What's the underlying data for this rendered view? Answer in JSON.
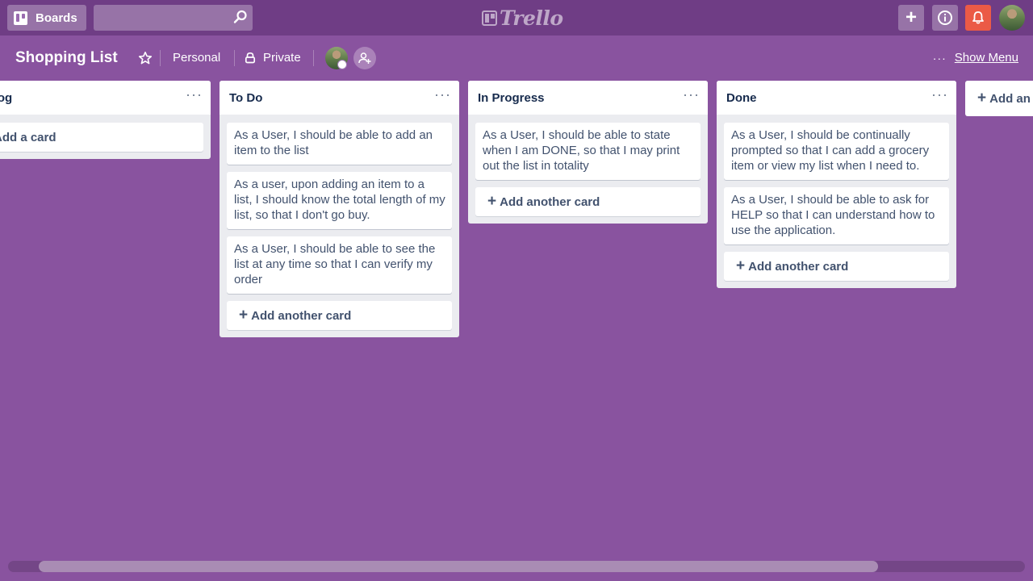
{
  "header": {
    "boards_label": "Boards",
    "search_value": "",
    "search_placeholder": "",
    "logo_text": "Trello",
    "add_icon_glyph": "+",
    "accent_color": "#6f3d85",
    "notification_color": "#eb5a46"
  },
  "board": {
    "title": "Shopping List",
    "team": "Personal",
    "visibility": "Private",
    "show_menu": "Show Menu",
    "more_glyph": "···",
    "background_color": "#89539f"
  },
  "lists": [
    {
      "title": "cklog",
      "more_glyph": "···",
      "cards": [],
      "add_label": "Add a card",
      "add_prefix": ""
    },
    {
      "title": "To Do",
      "more_glyph": "···",
      "cards": [
        "As a User, I should be able to add an item to the list",
        "As a user, upon adding an item to a list, I should know the total length of my list, so that I don't go buy.",
        "As a User, I should be able to see the list at any time so that I can verify my order"
      ],
      "add_label": "Add another card",
      "add_prefix": "+"
    },
    {
      "title": "In Progress",
      "more_glyph": "···",
      "cards": [
        "As a User, I should be able to state when I am DONE, so that I may print out the list in totality"
      ],
      "add_label": "Add another card",
      "add_prefix": "+"
    },
    {
      "title": "Done",
      "more_glyph": "···",
      "cards": [
        "As a User, I should be continually prompted so that I can add a grocery item or view my list when I need to.",
        "As a User, I should be able to ask for HELP so that I can understand how to use the application."
      ],
      "add_label": "Add another card",
      "add_prefix": "+"
    }
  ],
  "add_list": {
    "prefix": "+",
    "label": "Add an"
  }
}
